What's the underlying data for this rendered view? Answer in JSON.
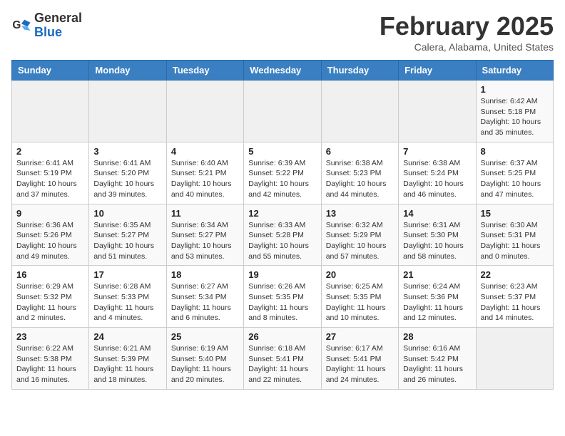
{
  "logo": {
    "text_general": "General",
    "text_blue": "Blue"
  },
  "title": "February 2025",
  "location": "Calera, Alabama, United States",
  "days_of_week": [
    "Sunday",
    "Monday",
    "Tuesday",
    "Wednesday",
    "Thursday",
    "Friday",
    "Saturday"
  ],
  "weeks": [
    [
      {
        "day": "",
        "info": ""
      },
      {
        "day": "",
        "info": ""
      },
      {
        "day": "",
        "info": ""
      },
      {
        "day": "",
        "info": ""
      },
      {
        "day": "",
        "info": ""
      },
      {
        "day": "",
        "info": ""
      },
      {
        "day": "1",
        "info": "Sunrise: 6:42 AM\nSunset: 5:18 PM\nDaylight: 10 hours\nand 35 minutes."
      }
    ],
    [
      {
        "day": "2",
        "info": "Sunrise: 6:41 AM\nSunset: 5:19 PM\nDaylight: 10 hours\nand 37 minutes."
      },
      {
        "day": "3",
        "info": "Sunrise: 6:41 AM\nSunset: 5:20 PM\nDaylight: 10 hours\nand 39 minutes."
      },
      {
        "day": "4",
        "info": "Sunrise: 6:40 AM\nSunset: 5:21 PM\nDaylight: 10 hours\nand 40 minutes."
      },
      {
        "day": "5",
        "info": "Sunrise: 6:39 AM\nSunset: 5:22 PM\nDaylight: 10 hours\nand 42 minutes."
      },
      {
        "day": "6",
        "info": "Sunrise: 6:38 AM\nSunset: 5:23 PM\nDaylight: 10 hours\nand 44 minutes."
      },
      {
        "day": "7",
        "info": "Sunrise: 6:38 AM\nSunset: 5:24 PM\nDaylight: 10 hours\nand 46 minutes."
      },
      {
        "day": "8",
        "info": "Sunrise: 6:37 AM\nSunset: 5:25 PM\nDaylight: 10 hours\nand 47 minutes."
      }
    ],
    [
      {
        "day": "9",
        "info": "Sunrise: 6:36 AM\nSunset: 5:26 PM\nDaylight: 10 hours\nand 49 minutes."
      },
      {
        "day": "10",
        "info": "Sunrise: 6:35 AM\nSunset: 5:27 PM\nDaylight: 10 hours\nand 51 minutes."
      },
      {
        "day": "11",
        "info": "Sunrise: 6:34 AM\nSunset: 5:27 PM\nDaylight: 10 hours\nand 53 minutes."
      },
      {
        "day": "12",
        "info": "Sunrise: 6:33 AM\nSunset: 5:28 PM\nDaylight: 10 hours\nand 55 minutes."
      },
      {
        "day": "13",
        "info": "Sunrise: 6:32 AM\nSunset: 5:29 PM\nDaylight: 10 hours\nand 57 minutes."
      },
      {
        "day": "14",
        "info": "Sunrise: 6:31 AM\nSunset: 5:30 PM\nDaylight: 10 hours\nand 58 minutes."
      },
      {
        "day": "15",
        "info": "Sunrise: 6:30 AM\nSunset: 5:31 PM\nDaylight: 11 hours\nand 0 minutes."
      }
    ],
    [
      {
        "day": "16",
        "info": "Sunrise: 6:29 AM\nSunset: 5:32 PM\nDaylight: 11 hours\nand 2 minutes."
      },
      {
        "day": "17",
        "info": "Sunrise: 6:28 AM\nSunset: 5:33 PM\nDaylight: 11 hours\nand 4 minutes."
      },
      {
        "day": "18",
        "info": "Sunrise: 6:27 AM\nSunset: 5:34 PM\nDaylight: 11 hours\nand 6 minutes."
      },
      {
        "day": "19",
        "info": "Sunrise: 6:26 AM\nSunset: 5:35 PM\nDaylight: 11 hours\nand 8 minutes."
      },
      {
        "day": "20",
        "info": "Sunrise: 6:25 AM\nSunset: 5:35 PM\nDaylight: 11 hours\nand 10 minutes."
      },
      {
        "day": "21",
        "info": "Sunrise: 6:24 AM\nSunset: 5:36 PM\nDaylight: 11 hours\nand 12 minutes."
      },
      {
        "day": "22",
        "info": "Sunrise: 6:23 AM\nSunset: 5:37 PM\nDaylight: 11 hours\nand 14 minutes."
      }
    ],
    [
      {
        "day": "23",
        "info": "Sunrise: 6:22 AM\nSunset: 5:38 PM\nDaylight: 11 hours\nand 16 minutes."
      },
      {
        "day": "24",
        "info": "Sunrise: 6:21 AM\nSunset: 5:39 PM\nDaylight: 11 hours\nand 18 minutes."
      },
      {
        "day": "25",
        "info": "Sunrise: 6:19 AM\nSunset: 5:40 PM\nDaylight: 11 hours\nand 20 minutes."
      },
      {
        "day": "26",
        "info": "Sunrise: 6:18 AM\nSunset: 5:41 PM\nDaylight: 11 hours\nand 22 minutes."
      },
      {
        "day": "27",
        "info": "Sunrise: 6:17 AM\nSunset: 5:41 PM\nDaylight: 11 hours\nand 24 minutes."
      },
      {
        "day": "28",
        "info": "Sunrise: 6:16 AM\nSunset: 5:42 PM\nDaylight: 11 hours\nand 26 minutes."
      },
      {
        "day": "",
        "info": ""
      }
    ]
  ]
}
